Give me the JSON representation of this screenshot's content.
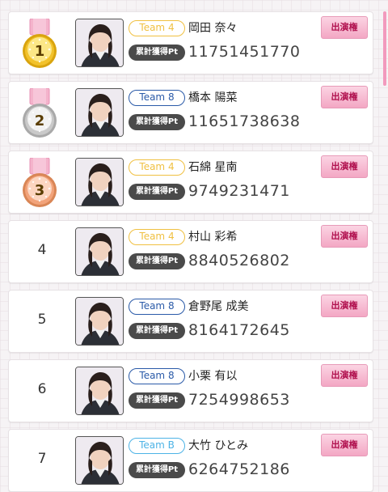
{
  "rows": [
    {
      "rank": "1",
      "team": "Team 4",
      "name": "岡田 奈々",
      "points_label": "累計獲得Pt",
      "points": "11751451770",
      "button": "出演権",
      "medal": "gold",
      "team_color": "#f0c041"
    },
    {
      "rank": "2",
      "team": "Team 8",
      "name": "橋本 陽菜",
      "points_label": "累計獲得Pt",
      "points": "11651738638",
      "button": "出演権",
      "medal": "silver",
      "team_color": "#2a5aa8"
    },
    {
      "rank": "3",
      "team": "Team 4",
      "name": "石綿 星南",
      "points_label": "累計獲得Pt",
      "points": "9749231471",
      "button": "出演権",
      "medal": "bronze",
      "team_color": "#f0c041"
    },
    {
      "rank": "4",
      "team": "Team 4",
      "name": "村山 彩希",
      "points_label": "累計獲得Pt",
      "points": "8840526802",
      "button": "出演権",
      "medal": "",
      "team_color": "#f0c041"
    },
    {
      "rank": "5",
      "team": "Team 8",
      "name": "倉野尾 成美",
      "points_label": "累計獲得Pt",
      "points": "8164172645",
      "button": "出演権",
      "medal": "",
      "team_color": "#2a5aa8"
    },
    {
      "rank": "6",
      "team": "Team 8",
      "name": "小栗 有以",
      "points_label": "累計獲得Pt",
      "points": "7254998653",
      "button": "出演権",
      "medal": "",
      "team_color": "#2a5aa8"
    },
    {
      "rank": "7",
      "team": "Team B",
      "name": "大竹 ひとみ",
      "points_label": "累計獲得Pt",
      "points": "6264752186",
      "button": "出演権",
      "medal": "",
      "team_color": "#4db3e6"
    }
  ]
}
